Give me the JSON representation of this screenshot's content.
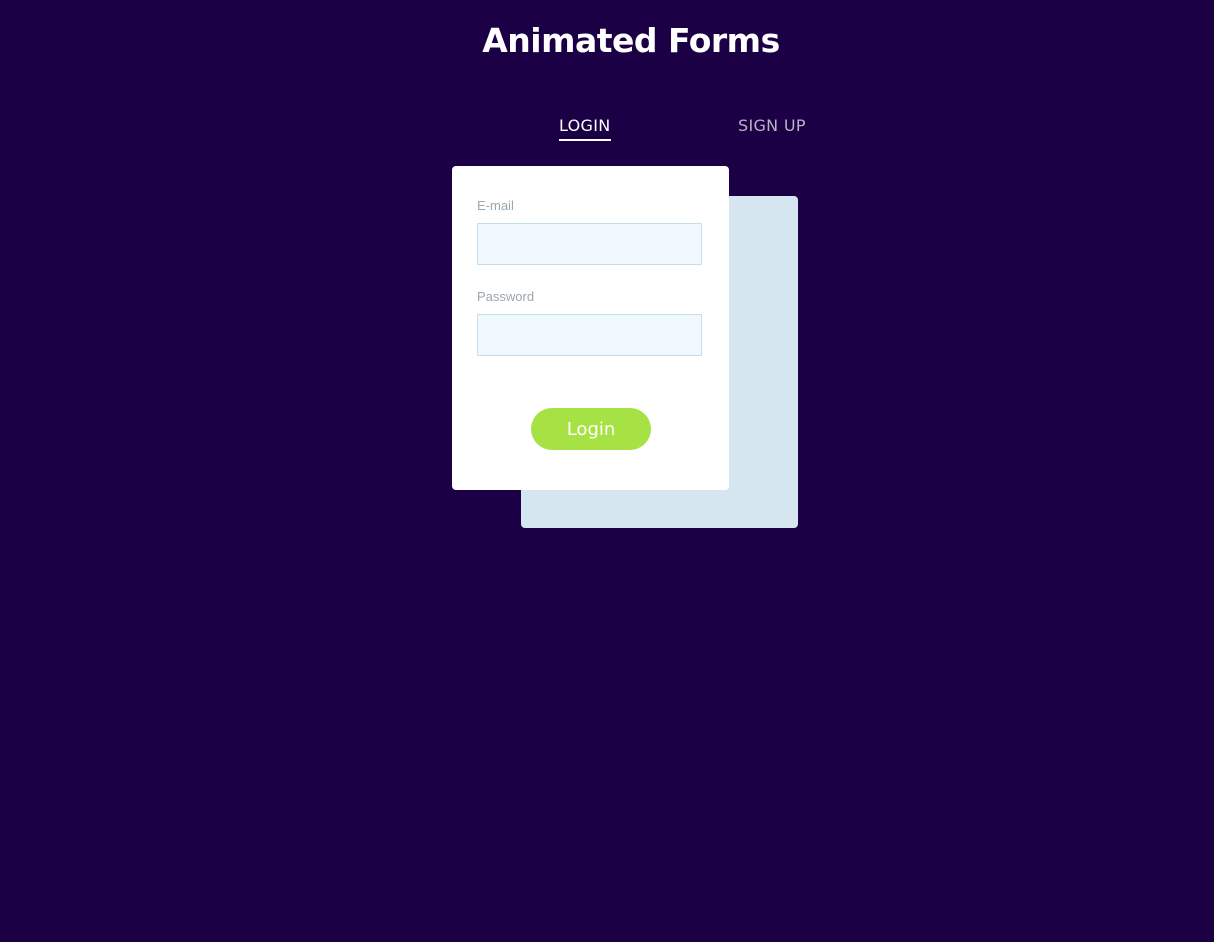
{
  "header": {
    "title": "Animated Forms"
  },
  "tabs": [
    {
      "label": "LOGIN",
      "active": true
    },
    {
      "label": "SIGN UP",
      "active": false
    }
  ],
  "form": {
    "email_label": "E-mail",
    "email_value": "",
    "password_label": "Password",
    "password_value": "",
    "submit_label": "Login"
  },
  "colors": {
    "background": "#1b0046",
    "card": "#ffffff",
    "back_card": "#d5e6f1",
    "input_bg": "#eff8ff",
    "button": "#a7e245",
    "label": "#9aa6ad"
  }
}
